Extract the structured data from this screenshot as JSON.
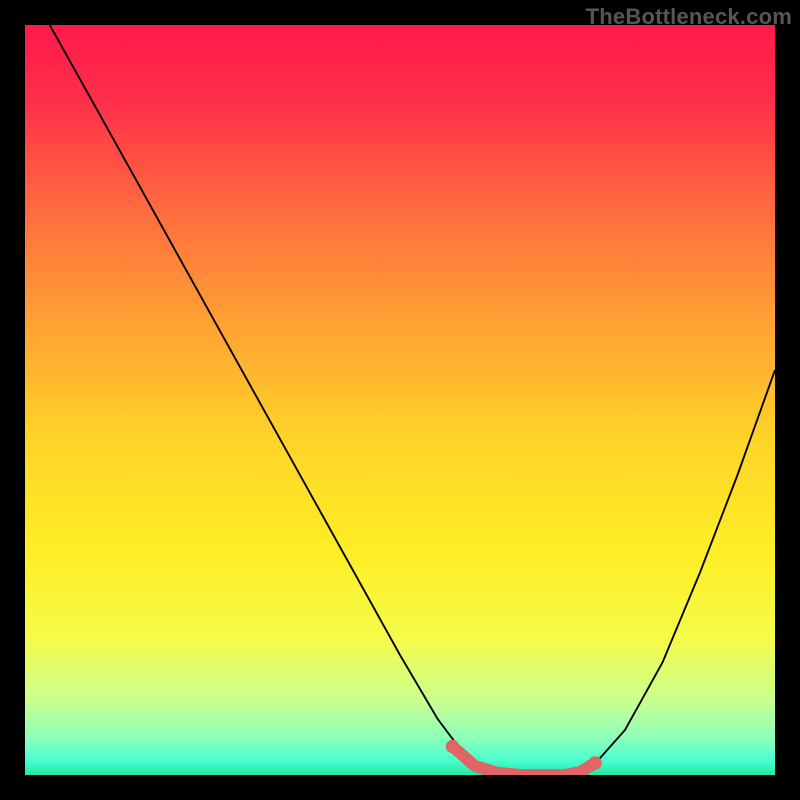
{
  "attribution": "TheBottleneck.com",
  "chart_data": {
    "type": "line",
    "title": "",
    "xlabel": "",
    "ylabel": "",
    "xlim": [
      0,
      100
    ],
    "ylim": [
      0,
      100
    ],
    "grid": false,
    "legend": false,
    "series": [
      {
        "name": "bottleneck-curve",
        "x": [
          3.3,
          10,
          20,
          30,
          40,
          50,
          55,
          58,
          60,
          62,
          65,
          67,
          70,
          72,
          74,
          76,
          80,
          85,
          90,
          95,
          100
        ],
        "y": [
          100,
          88,
          70,
          52,
          34,
          16,
          7.5,
          3.5,
          1.5,
          0.5,
          0,
          0,
          0,
          0,
          0.5,
          1.5,
          6,
          15,
          27,
          40,
          54
        ],
        "color": "#000000"
      },
      {
        "name": "sweet-spot-marker",
        "x": [
          57,
          60,
          63,
          66,
          69,
          72,
          74,
          76
        ],
        "y": [
          3.8,
          1.2,
          0.3,
          0,
          0,
          0,
          0.4,
          1.6
        ],
        "color": "#e06666"
      }
    ],
    "background_gradient_stops": [
      {
        "offset": 0.0,
        "color": "#ff1a4b"
      },
      {
        "offset": 0.1,
        "color": "#ff2e4a"
      },
      {
        "offset": 0.25,
        "color": "#ff6d3f"
      },
      {
        "offset": 0.4,
        "color": "#ffa233"
      },
      {
        "offset": 0.55,
        "color": "#ffd328"
      },
      {
        "offset": 0.7,
        "color": "#feee25"
      },
      {
        "offset": 0.82,
        "color": "#f4fb4a"
      },
      {
        "offset": 0.9,
        "color": "#caff8f"
      },
      {
        "offset": 0.95,
        "color": "#8dffba"
      },
      {
        "offset": 0.98,
        "color": "#4bffcf"
      },
      {
        "offset": 1.0,
        "color": "#24e7a8"
      }
    ]
  }
}
